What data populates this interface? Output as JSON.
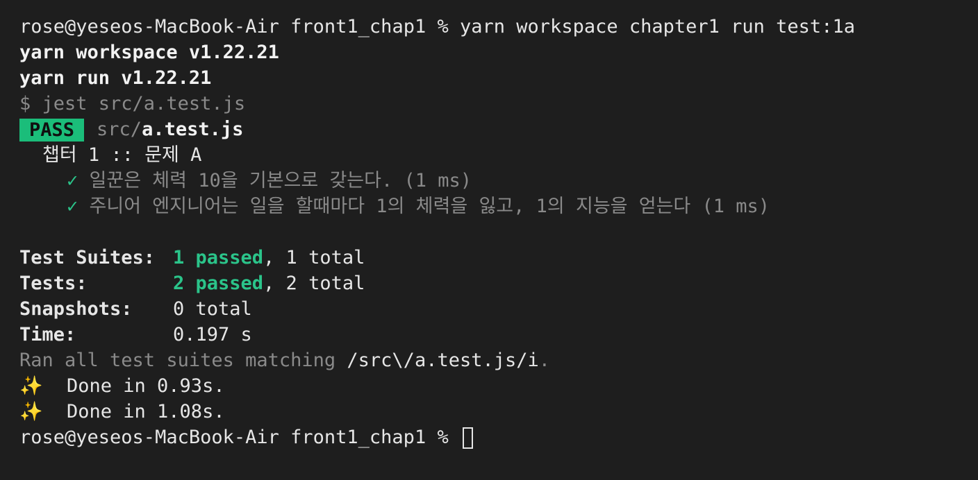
{
  "prompt": {
    "user_host": "rose@yeseos-MacBook-Air",
    "dir": "front1_chap1",
    "symbol": "%",
    "command": "yarn workspace chapter1 run test:1a"
  },
  "yarn_lines": [
    "yarn workspace v1.22.21",
    "yarn run v1.22.21"
  ],
  "jest_command": "$ jest src/a.test.js",
  "result": {
    "badge": "PASS",
    "path_dim": "src/",
    "path_file": "a.test.js"
  },
  "describe": "챕터 1 :: 문제 A",
  "tests": [
    {
      "check": "✓",
      "text": "일꾼은 체력 10을 기본으로 갖는다. (1 ms)"
    },
    {
      "check": "✓",
      "text": "주니어 엔지니어는 일을 할때마다 1의 체력을 잃고, 1의 지능을 얻는다 (1 ms)"
    }
  ],
  "summary": {
    "suites_label": "Test Suites:",
    "suites_passed": "1 passed",
    "suites_total": ", 1 total",
    "tests_label": "Tests:",
    "tests_passed": "2 passed",
    "tests_total": ", 2 total",
    "snapshots_label": "Snapshots:",
    "snapshots_value": "0 total",
    "time_label": "Time:",
    "time_value": "0.197 s"
  },
  "ran_line": {
    "dim_text": "Ran all test suites matching ",
    "pattern": "/src\\/a.test.js/i",
    "dot": "."
  },
  "done_lines": [
    {
      "icon": "✨",
      "text": "Done in 0.93s."
    },
    {
      "icon": "✨",
      "text": "Done in 1.08s."
    }
  ],
  "final_prompt": "rose@yeseos-MacBook-Air front1_chap1 % ",
  "colors": {
    "background": "#1e1e1e",
    "pass_badge": "#1bbd7a",
    "passed_text": "#2bc48a",
    "dim_text": "#8a8a8a"
  }
}
